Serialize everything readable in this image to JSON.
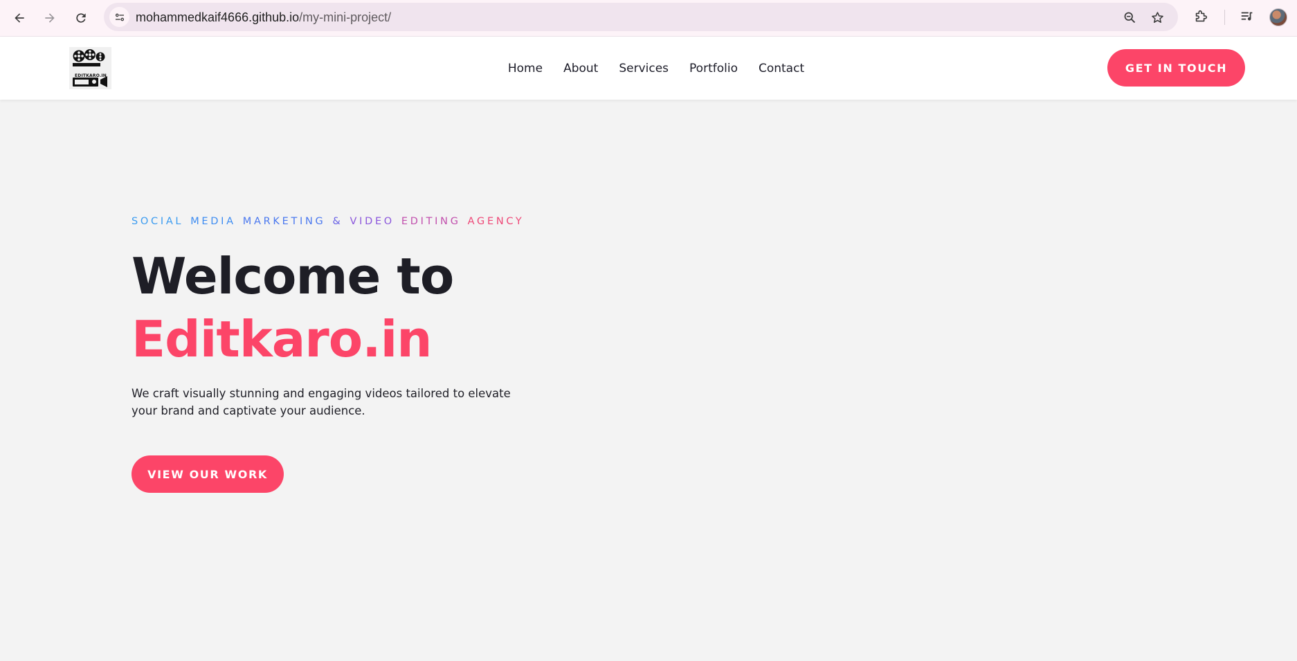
{
  "browser": {
    "url_host": "mohammedkaif4666.github.io",
    "url_path": "/my-mini-project/",
    "icons": [
      "back-icon",
      "forward-icon",
      "reload-icon",
      "site-info-icon",
      "zoom-icon",
      "bookmark-star-icon",
      "extensions-icon",
      "media-controls-icon",
      "profile-avatar"
    ]
  },
  "header": {
    "logo_text": "EDITKARO.IN",
    "nav": [
      "Home",
      "About",
      "Services",
      "Portfolio",
      "Contact"
    ],
    "cta_label": "GET IN TOUCH"
  },
  "hero": {
    "tagline_words": [
      {
        "text": "SOCIAL",
        "color": "#3a9bf0"
      },
      {
        "text": "MEDIA",
        "color": "#3d8cf2"
      },
      {
        "text": "MARKETING",
        "color": "#4a78ef"
      },
      {
        "text": "&",
        "color": "#6a63e6"
      },
      {
        "text": "VIDEO",
        "color": "#8b56dc"
      },
      {
        "text": "EDITING",
        "color": "#c14fad"
      },
      {
        "text": "AGENCY",
        "color": "#ee4777"
      }
    ],
    "title_line1": "Welcome to",
    "title_line2": "Editkaro.in",
    "description": "We craft visually stunning and engaging videos tailored to elevate your brand and captivate your audience.",
    "cta_label": "VIEW OUR WORK"
  },
  "colors": {
    "accent": "#fc4568",
    "hero_bg": "#f3f3f3",
    "heading": "#1e1e26"
  }
}
